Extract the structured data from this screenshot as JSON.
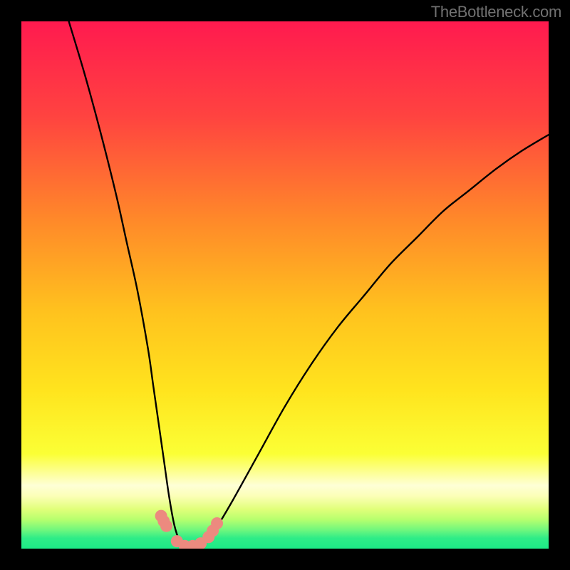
{
  "attribution": "TheBottleneck.com",
  "colors": {
    "gradient_top": "#ff1a4f",
    "gradient_upper_mid": "#ff6a2b",
    "gradient_mid": "#ffd21a",
    "gradient_lower_mid": "#f7ff37",
    "gradient_pale_band": "#feffd6",
    "gradient_green": "#1dea86",
    "curve_stroke": "#000000",
    "marker_fill": "#ec8a7f",
    "frame_bg": "#000000"
  },
  "chart_data": {
    "type": "line",
    "title": "",
    "xlabel": "",
    "ylabel": "",
    "xlim": [
      0,
      100
    ],
    "ylim": [
      0,
      100
    ],
    "series": [
      {
        "name": "bottleneck-curve",
        "x": [
          9,
          12,
          15,
          18,
          20,
          22,
          24,
          25,
          26,
          27,
          28,
          29,
          30,
          31,
          32,
          33,
          34,
          35,
          37,
          40,
          45,
          50,
          55,
          60,
          65,
          70,
          75,
          80,
          85,
          90,
          95,
          100
        ],
        "y": [
          100,
          90,
          79,
          67,
          58,
          49,
          38,
          31,
          24,
          17,
          10,
          4.5,
          1.5,
          0.5,
          0,
          0,
          0.5,
          1.5,
          4,
          9,
          18,
          27,
          35,
          42,
          48,
          54,
          59,
          64,
          68,
          72,
          75.5,
          78.5
        ]
      }
    ],
    "markers": {
      "name": "highlight-points",
      "x": [
        26.5,
        27.0,
        27.5,
        29.5,
        31.0,
        32.5,
        34.0,
        35.5,
        36.3,
        37.1
      ],
      "y": [
        6.2,
        5.2,
        4.3,
        1.4,
        0.5,
        0.5,
        1.0,
        2.2,
        3.4,
        4.8
      ]
    }
  }
}
